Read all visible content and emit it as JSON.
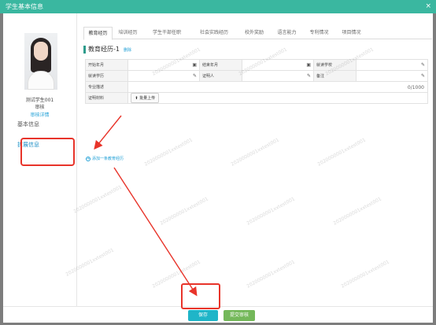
{
  "window": {
    "title": "学生基本信息",
    "close": "×"
  },
  "student": {
    "name": "测试学生001",
    "status": "审核",
    "detail_link": "审核详情"
  },
  "nav": {
    "basic": "基本信息",
    "extended": "扩展信息"
  },
  "tabs": [
    {
      "label": "教育经历"
    },
    {
      "label": "培训经历"
    },
    {
      "label": "学生干部任职"
    },
    {
      "label": "社会实践经历"
    },
    {
      "label": "校外奖励"
    },
    {
      "label": "语言能力"
    },
    {
      "label": "专利情况"
    },
    {
      "label": "项目情况"
    }
  ],
  "section": {
    "title": "教育经历-1",
    "delete_link": "删除"
  },
  "form": {
    "start_date": "开始年月",
    "end_date": "结束年月",
    "school": "就读学校",
    "degree": "就读学历",
    "witness": "证明人",
    "remark": "备注",
    "major_desc": "专业描述",
    "counter": "0/1000",
    "proof": "证明材料",
    "upload": "批量上传"
  },
  "add_more": "添加一条教育经历",
  "buttons": {
    "save": "保存",
    "submit": "提交审核"
  },
  "watermark": "2020000001xxtest001",
  "colors": {
    "header": "#3ab7a0",
    "save": "#1fb5c8",
    "submit": "#74b85a",
    "highlight": "#e8342a",
    "link": "#1f9fd6"
  },
  "icons": {
    "calendar": "calendar-icon",
    "edit": "pencil-icon",
    "upload": "upload-icon",
    "add": "plus-circle-icon"
  }
}
